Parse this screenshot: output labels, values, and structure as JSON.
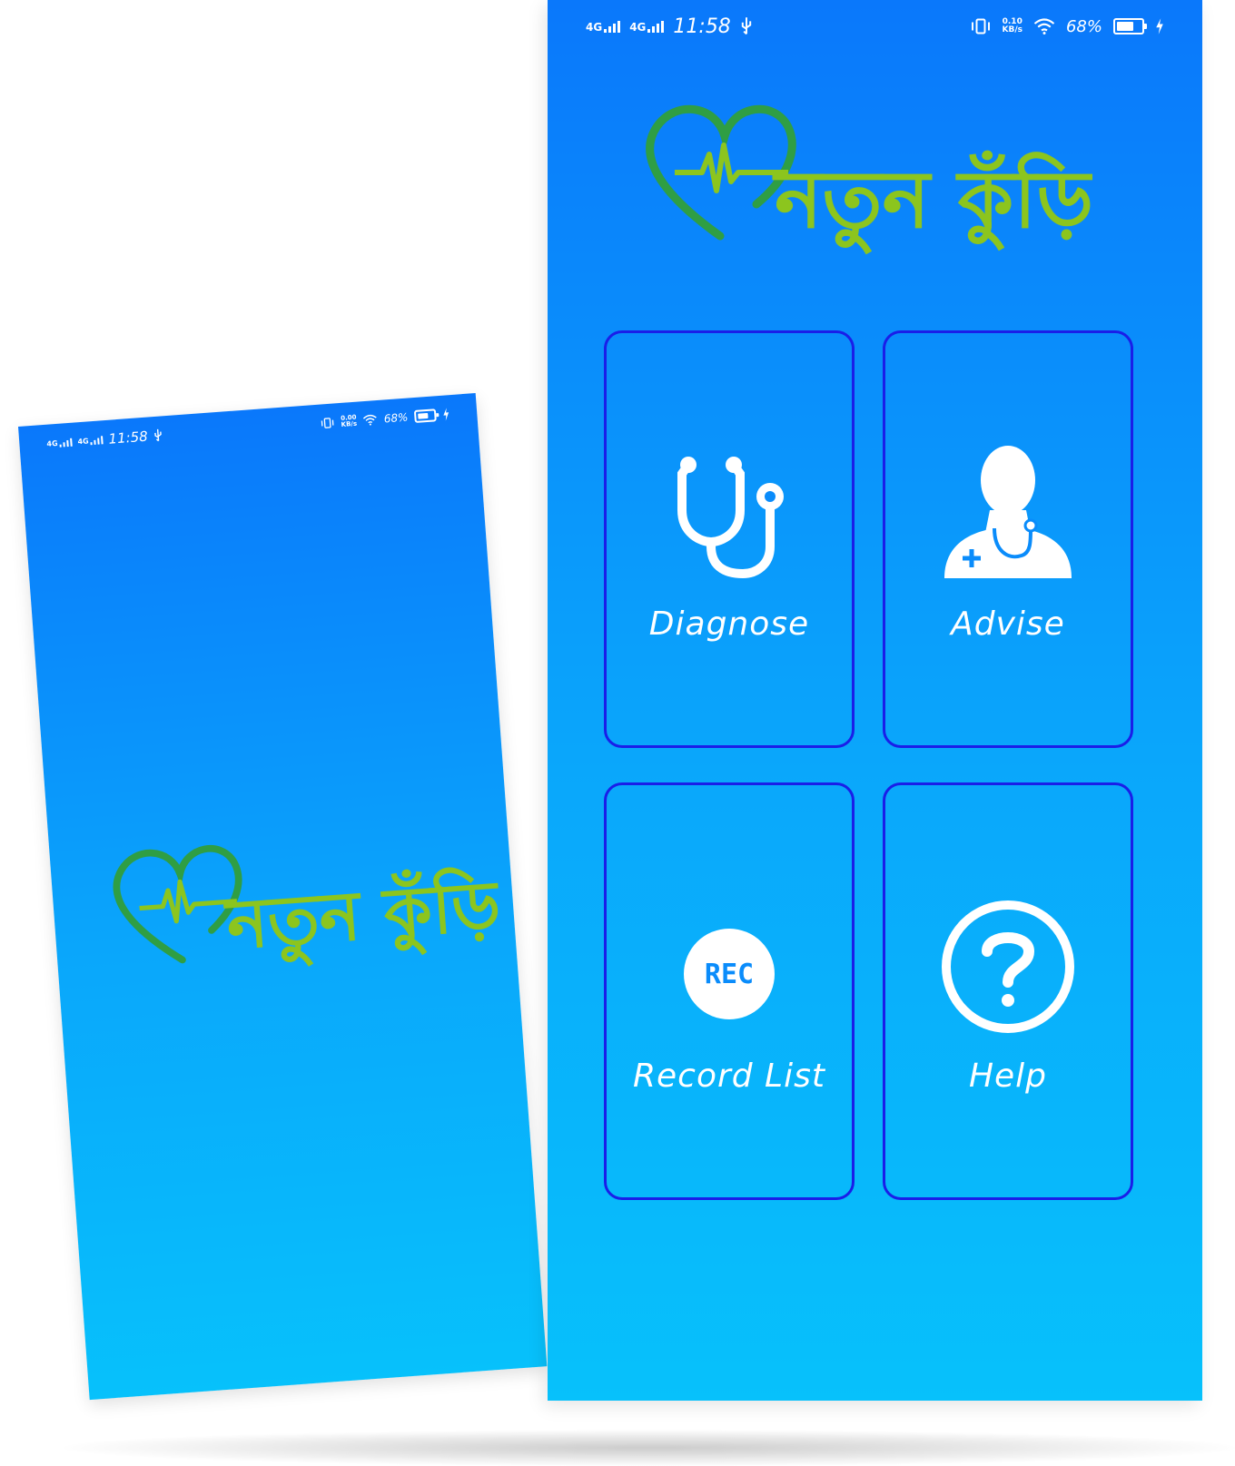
{
  "status_bar_front": {
    "network_1": "4G",
    "network_2": "4G",
    "time": "11:58",
    "speed_value": "0.10",
    "speed_unit": "KB/s",
    "battery_pct": "68%"
  },
  "status_bar_back": {
    "network_1": "4G",
    "network_2": "4G",
    "time": "11:58",
    "speed_value": "0.00",
    "speed_unit": "KB/s",
    "battery_pct": "68%"
  },
  "battery_level": 0.68,
  "app": {
    "logo_text": "নতুন কুঁড়ি"
  },
  "menu": {
    "diagnose_label": "Diagnose",
    "advise_label": "Advise",
    "record_label": "Record List",
    "rec_badge": "REC",
    "help_label": "Help"
  },
  "colors": {
    "bg_top": "#0a78fb",
    "bg_bottom": "#07c1fb",
    "tile_border": "#1a1ee8",
    "logo_green": "#8cc51e",
    "heart_green": "#2f9e44"
  },
  "icons": [
    "stethoscope-icon",
    "doctor-icon",
    "rec-icon",
    "help-icon",
    "usb-icon",
    "vibrate-icon",
    "wifi-icon",
    "battery-icon",
    "charging-icon"
  ]
}
